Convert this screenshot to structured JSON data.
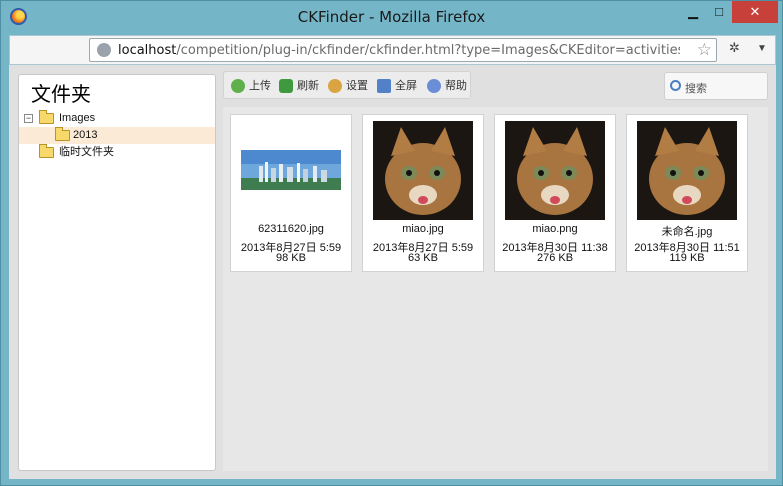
{
  "window": {
    "title": "CKFinder - Mozilla Firefox",
    "controls": {
      "minimize": "▁",
      "maximize": "□",
      "close": "✕"
    }
  },
  "address_bar": {
    "host": "localhost",
    "path": "/competition/plug-in/ckfinder/ckfinder.html?type=Images&CKEditor=activitiesGeneralInformation&CKE"
  },
  "sidebar": {
    "title": "文件夹",
    "tree": [
      {
        "label": "Images",
        "expander": "−",
        "selected": false
      },
      {
        "label": "2013",
        "selected": true
      },
      {
        "label": "临时文件夹",
        "selected": false
      }
    ]
  },
  "toolbar": {
    "upload": "上传",
    "refresh": "刷新",
    "settings": "设置",
    "maximize": "全屏",
    "help": "帮助"
  },
  "search": {
    "label": "搜索"
  },
  "files": [
    {
      "name": "62311620.jpg",
      "date": "2013年8月27日 5:59",
      "size": "98 KB",
      "thumb": "banner"
    },
    {
      "name": "miao.jpg",
      "date": "2013年8月27日 5:59",
      "size": "63 KB",
      "thumb": "cat"
    },
    {
      "name": "miao.png",
      "date": "2013年8月30日 11:38",
      "size": "276 KB",
      "thumb": "cat"
    },
    {
      "name": "未命名.jpg",
      "date": "2013年8月30日 11:51",
      "size": "119 KB",
      "thumb": "cat"
    }
  ],
  "colors": {
    "window_frame": "#74b6c7",
    "close_button": "#c7413a",
    "selected_row": "#fbead6",
    "folder": "#f7d96b"
  }
}
